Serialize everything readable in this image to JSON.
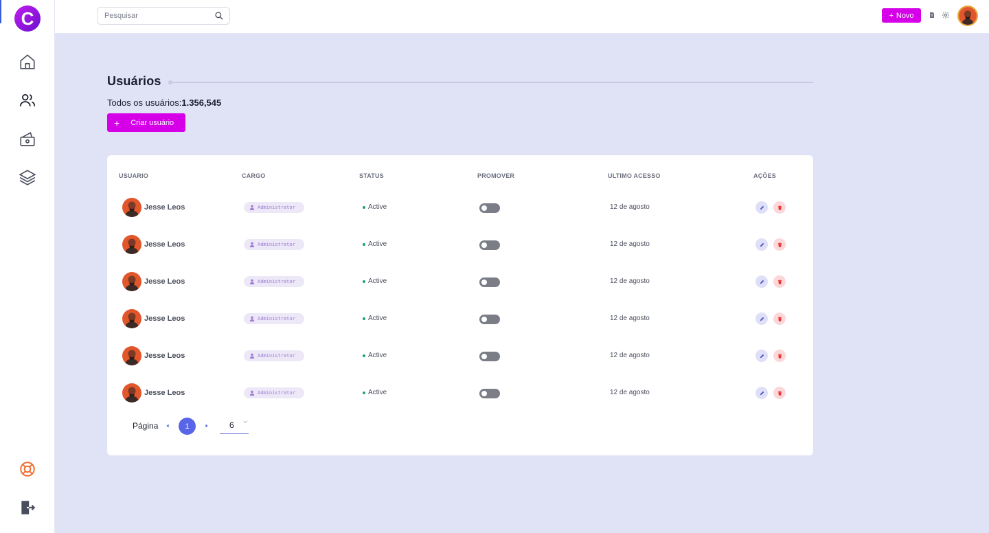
{
  "app": {
    "logo_letter": "C"
  },
  "topbar": {
    "search_placeholder": "Pesquisar",
    "new_button_label": "Novo"
  },
  "page": {
    "title": "Usuários",
    "total_label": "Todos os usuários:",
    "total_value": "1.356,545",
    "create_button_label": "Criar usuário"
  },
  "table": {
    "headers": [
      "USUARIO",
      "CARGO",
      "STATUS",
      "PROMOVER",
      "ULTIMO ACESSO",
      "AÇÕES"
    ],
    "rows": [
      {
        "name": "Jesse Leos",
        "role": "Administrator",
        "status": "Active",
        "promoted": false,
        "last_access": "12 de agosto"
      },
      {
        "name": "Jesse Leos",
        "role": "Administrator",
        "status": "Active",
        "promoted": false,
        "last_access": "12 de agosto"
      },
      {
        "name": "Jesse Leos",
        "role": "Administrator",
        "status": "Active",
        "promoted": false,
        "last_access": "12 de agosto"
      },
      {
        "name": "Jesse Leos",
        "role": "Administrator",
        "status": "Active",
        "promoted": false,
        "last_access": "12 de agosto"
      },
      {
        "name": "Jesse Leos",
        "role": "Administrator",
        "status": "Active",
        "promoted": false,
        "last_access": "12 de agosto"
      },
      {
        "name": "Jesse Leos",
        "role": "Administrator",
        "status": "Active",
        "promoted": false,
        "last_access": "12 de agosto"
      }
    ]
  },
  "pagination": {
    "label": "Página",
    "current_page": "1",
    "page_size": "6"
  },
  "colors": {
    "accent": "#d500e8",
    "page_active": "#5865e8",
    "status_active": "#1ea26a",
    "background": "#dfe3f5"
  }
}
